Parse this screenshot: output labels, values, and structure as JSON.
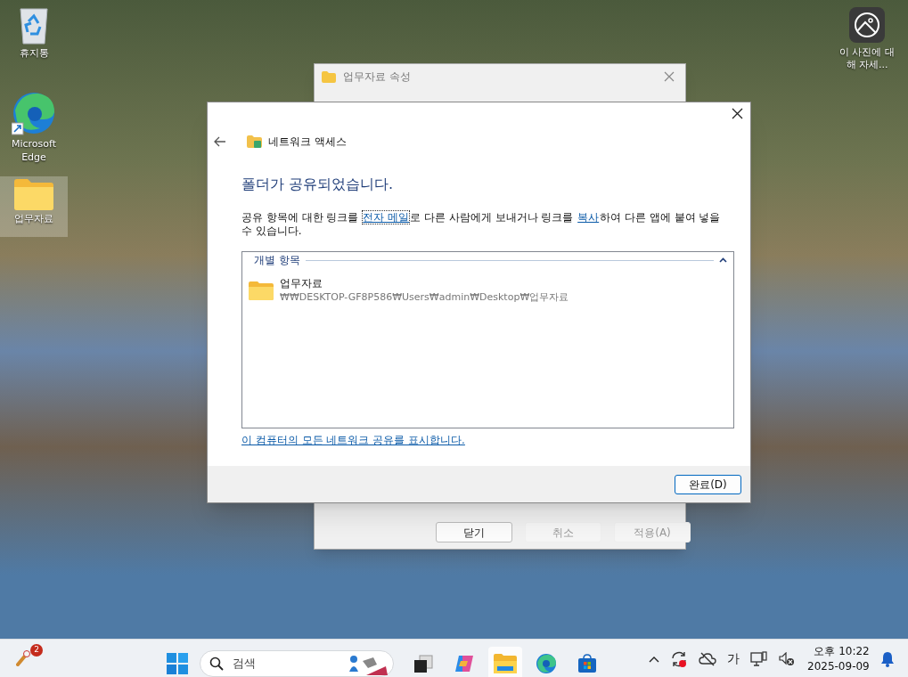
{
  "desktop_icons": [
    {
      "kind": "recycle",
      "label": "휴지통",
      "selected": false
    },
    {
      "kind": "edge",
      "label": "Microsoft Edge",
      "selected": false
    },
    {
      "kind": "folder",
      "label": "업무자료",
      "selected": true
    }
  ],
  "photo_info": {
    "label": "이 사진에 대해 자세..."
  },
  "back_window": {
    "title": "업무자료 속성",
    "buttons": [
      {
        "label": "닫기",
        "disabled": false
      },
      {
        "label": "취소",
        "disabled": true
      },
      {
        "label": "적용(A)",
        "disabled": true
      }
    ]
  },
  "dialog": {
    "title": "네트워크 액세스",
    "heading": "폴더가 공유되었습니다.",
    "message": [
      {
        "kind": "text",
        "text": "공유 항목에 대한 링크를 "
      },
      {
        "kind": "link",
        "text": "전자 메일",
        "focused": true
      },
      {
        "kind": "text",
        "text": "로 다른 사람에게 보내거나 링크를 "
      },
      {
        "kind": "link",
        "text": "복사",
        "focused": false
      },
      {
        "kind": "text",
        "text": "하여 다른 앱에 붙여 넣을 수 있습니다."
      }
    ],
    "group": {
      "title": "개별 항목",
      "expanded": true,
      "items": [
        {
          "name": "업무자료",
          "path": "₩₩DESKTOP-GF8P586₩Users₩admin₩Desktop₩업무자료"
        }
      ]
    },
    "shares_link": "이 컴퓨터의 모든 네트워크 공유를 표시합니다.",
    "button": "완료(D)"
  },
  "taskbar": {
    "widget_badge": "2",
    "search_placeholder": "검색",
    "apps": [
      {
        "kind": "taskview",
        "active": false
      },
      {
        "kind": "copilot",
        "active": false
      },
      {
        "kind": "explorer",
        "active": true
      },
      {
        "kind": "edge",
        "active": false
      },
      {
        "kind": "store",
        "active": false
      }
    ],
    "ime": "가",
    "time": "오후 10:22",
    "date": "2025-09-09"
  }
}
